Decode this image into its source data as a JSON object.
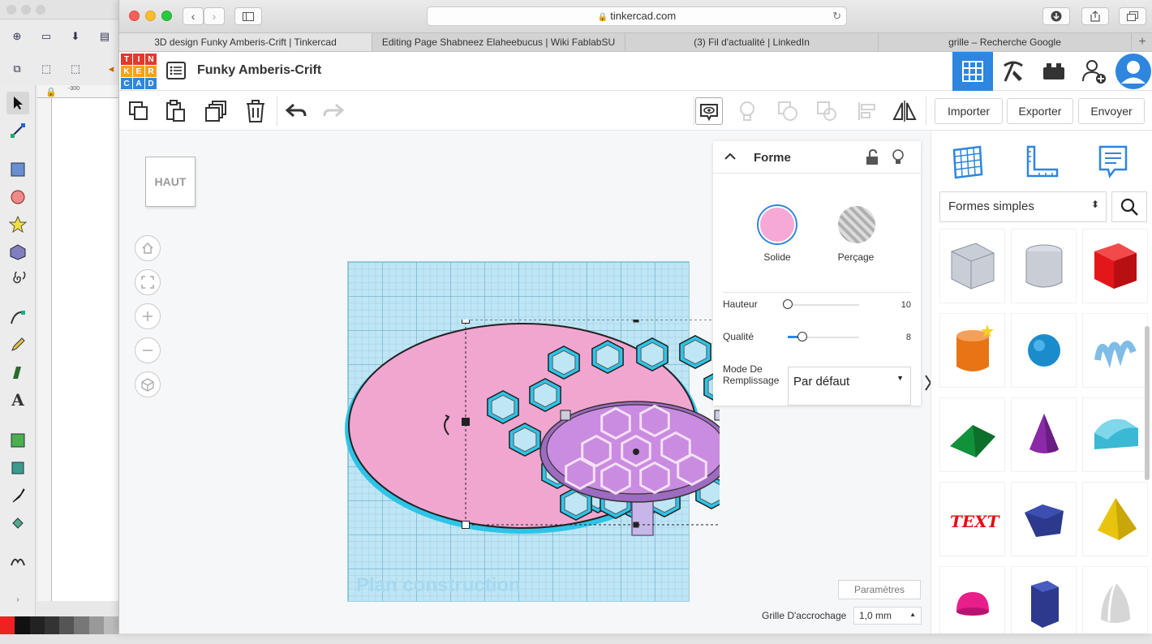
{
  "browser": {
    "url": "tinkercad.com",
    "tabs": [
      {
        "label": "3D design Funky Amberis-Crift | Tinkercad",
        "active": true
      },
      {
        "label": "Editing Page Shabneez Elaheebucus | Wiki FablabSU",
        "active": false
      },
      {
        "label": "(3) Fil d'actualité | LinkedIn",
        "active": false
      },
      {
        "label": "grille – Recherche Google",
        "active": false
      }
    ]
  },
  "app": {
    "logo_letters": [
      "T",
      "I",
      "N",
      "K",
      "E",
      "R",
      "C",
      "A",
      "D"
    ],
    "logo_colors": [
      "#e13a2c",
      "#e13a2c",
      "#e13a2c",
      "#f7a21b",
      "#f7a21b",
      "#f7a21b",
      "#2e86de",
      "#2e86de",
      "#2e86de"
    ],
    "design_name": "Funky Amberis-Crift",
    "toolbar": {
      "import_label": "Importer",
      "export_label": "Exporter",
      "send_label": "Envoyer"
    },
    "viewcube_label": "HAUT",
    "workplane_label": "Plan construction",
    "shape_panel": {
      "title": "Forme",
      "solid_label": "Solide",
      "hole_label": "Perçage",
      "solid_color": "#f6a8d6",
      "height_label": "Hauteur",
      "height_value": "10",
      "height_fraction": 0.0,
      "quality_label": "Qualité",
      "quality_value": "8",
      "quality_fraction": 0.2,
      "fill_mode_label_1": "Mode De",
      "fill_mode_label_2": "Remplissage",
      "fill_mode_value": "Par défaut"
    },
    "params_label": "Paramètres",
    "snap_label": "Grille D'accrochage",
    "snap_value": "1,0 mm",
    "library": {
      "category": "Formes simples",
      "shapes": [
        "box-hole",
        "cylinder-hole",
        "box",
        "cylinder",
        "sphere",
        "scribble",
        "roof",
        "cone",
        "round-roof",
        "text",
        "prism",
        "pyramid",
        "half-sphere",
        "polygon",
        "paraboloid"
      ]
    }
  },
  "background_app": {
    "ruler_value": "-300"
  },
  "colors": {
    "accent": "#2e86de",
    "workplane": "#bfe6f5",
    "model_pink": "#f1a6d0",
    "model_purple": "#c98ce0",
    "hex_outline": "#2ec4e8"
  }
}
